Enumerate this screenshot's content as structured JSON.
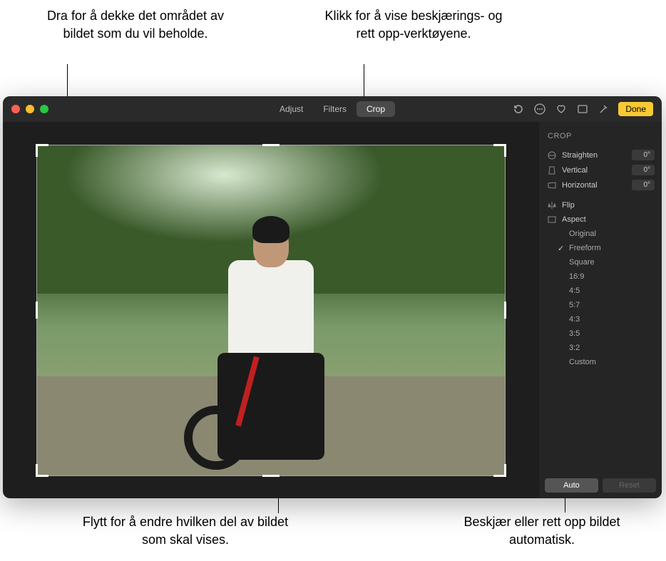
{
  "callouts": {
    "top_left": "Dra for å dekke det området av bildet som du vil beholde.",
    "top_right": "Klikk for å vise beskjærings- og rett opp-verktøyene.",
    "bottom_left": "Flytt for å endre hvilken del av bildet som skal vises.",
    "bottom_right": "Beskjær eller rett opp bildet automatisk."
  },
  "tabs": {
    "adjust": "Adjust",
    "filters": "Filters",
    "crop": "Crop"
  },
  "toolbar": {
    "done_label": "Done"
  },
  "sidebar": {
    "header": "CROP",
    "straighten": {
      "label": "Straighten",
      "value": "0°"
    },
    "vertical": {
      "label": "Vertical",
      "value": "0°"
    },
    "horizontal": {
      "label": "Horizontal",
      "value": "0°"
    },
    "flip_label": "Flip",
    "aspect_label": "Aspect",
    "aspect_options": {
      "original": "Original",
      "freeform": "Freeform",
      "square": "Square",
      "r16_9": "16:9",
      "r4_5": "4:5",
      "r5_7": "5:7",
      "r4_3": "4:3",
      "r3_5": "3:5",
      "r3_2": "3:2",
      "custom": "Custom"
    },
    "auto_label": "Auto",
    "reset_label": "Reset"
  }
}
